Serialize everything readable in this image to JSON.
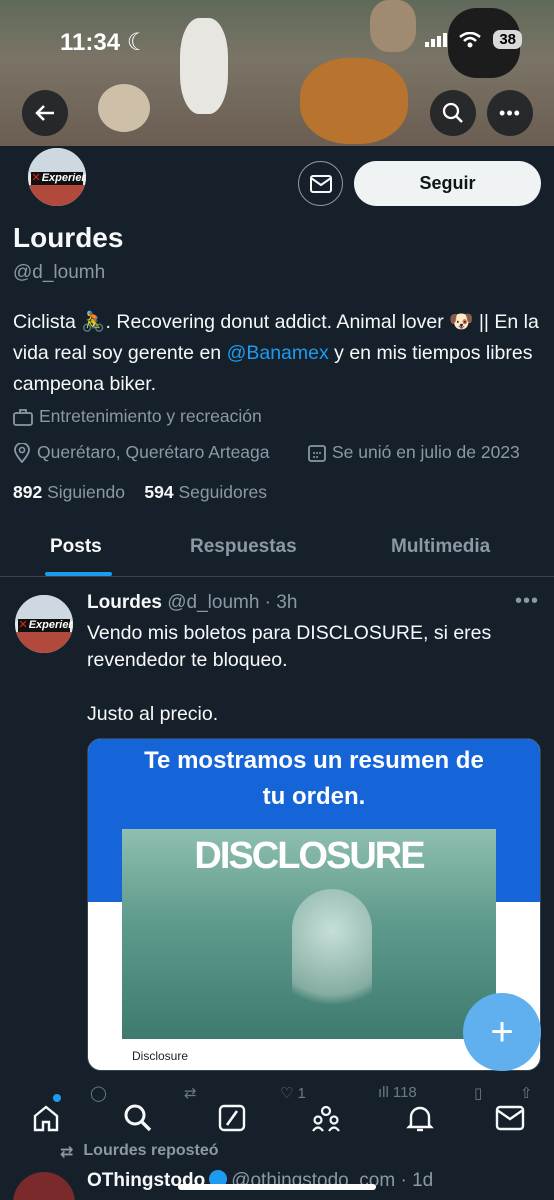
{
  "status_bar": {
    "time": "11:34",
    "battery": "38"
  },
  "header": {
    "back_icon": "arrow-left-icon",
    "search_icon": "search-icon",
    "more_icon": "more-icon"
  },
  "profile": {
    "name": "Lourdes",
    "handle": "@d_loumh",
    "avatar_text": "Experien",
    "follow_label": "Seguir",
    "bio": {
      "part1": "Ciclista 🚴. Recovering donut addict. Animal lover 🐶 || En la vida real soy gerente en ",
      "mention": "@Banamex",
      "part2": " y en mis tiempos libres campeona biker."
    },
    "category": "Entretenimiento y recreación",
    "location": "Querétaro, Querétaro Arteaga",
    "joined": "Se unió en julio de 2023",
    "following_count": "892",
    "following_label": "Siguiendo",
    "followers_count": "594",
    "followers_label": "Seguidores"
  },
  "tabs": {
    "posts": "Posts",
    "replies": "Respuestas",
    "media": "Multimedia"
  },
  "post": {
    "author": "Lourdes",
    "handle_time": "@d_loumh · 3h",
    "text_line1": "Vendo mis boletos para DISCLOSURE, si eres revendedor te bloqueo.",
    "text_line2": "Justo al precio.",
    "media": {
      "headline": "Te mostramos un resumen de tu orden.",
      "poster_title": "DISCLOSURE",
      "caption": "Disclosure"
    },
    "likes": "1",
    "views": "118"
  },
  "repost_label": "Lourdes reposteó",
  "next_post": {
    "author": "OThingstodo",
    "handle_time": "@othingstodo_com · 1d"
  },
  "colors": {
    "background": "#15202b",
    "accent": "#1d9bf0",
    "text": "#f7f9f9",
    "muted": "#8b98a5"
  }
}
